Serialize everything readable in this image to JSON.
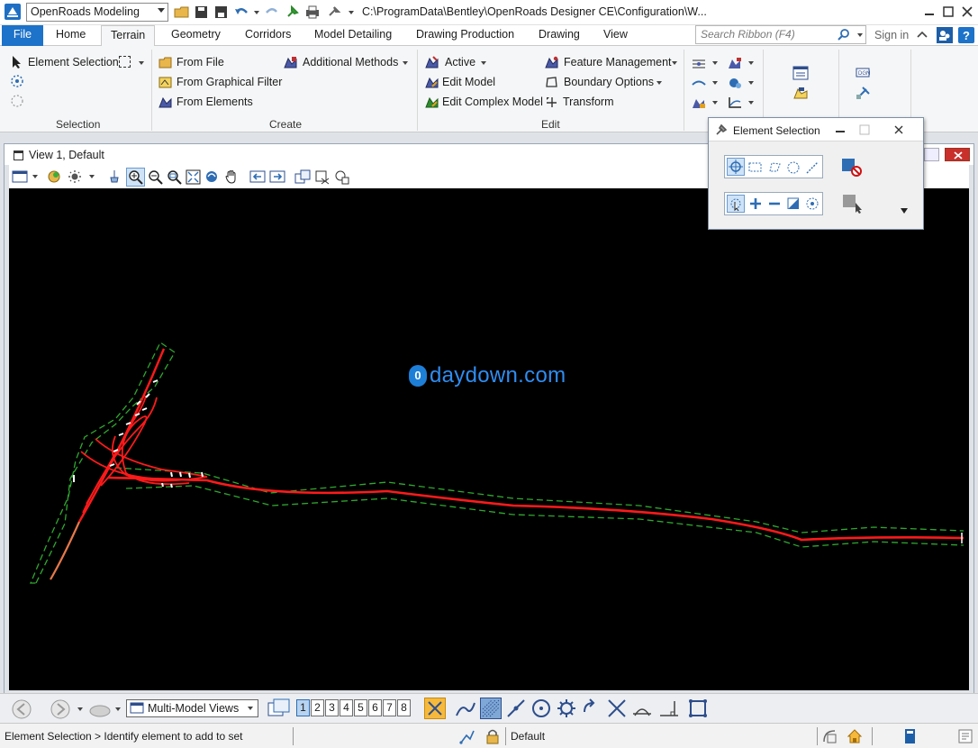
{
  "titlebar": {
    "workflow": "OpenRoads Modeling",
    "path": "C:\\ProgramData\\Bentley\\OpenRoads Designer CE\\Configuration\\W..."
  },
  "tabs": [
    "File",
    "Home",
    "Terrain",
    "Geometry",
    "Corridors",
    "Model Detailing",
    "Drawing Production",
    "Drawing",
    "View"
  ],
  "active_tab": "Terrain",
  "search": {
    "placeholder": "Search Ribbon (F4)"
  },
  "signin": "Sign in",
  "ribbon": {
    "selection": {
      "label": "Selection",
      "element_selection": "Element Selection"
    },
    "create": {
      "label": "Create",
      "from_file": "From File",
      "from_graphical_filter": "From Graphical Filter",
      "from_elements": "From Elements",
      "additional_methods": "Additional Methods"
    },
    "edit": {
      "label": "Edit",
      "active": "Active",
      "edit_model": "Edit Model",
      "edit_complex_model": "Edit Complex Model",
      "feature_management": "Feature Management",
      "boundary_options": "Boundary Options",
      "transform": "Transform"
    }
  },
  "view": {
    "title": "View 1, Default"
  },
  "dialog": {
    "title": "Element Selection"
  },
  "watermark": "daydown.com",
  "watermark_badge": "0",
  "bottom_toolbar": {
    "views_dropdown": "Multi-Model Views",
    "view_numbers": [
      "1",
      "2",
      "3",
      "4",
      "5",
      "6",
      "7",
      "8"
    ],
    "selected_view": "1"
  },
  "statusbar": {
    "prompt": "Element Selection > Identify element to add to set",
    "level": "Default"
  },
  "colors": {
    "accent": "#1d72c9",
    "alignment": "#ff1a1a",
    "boundary": "#2fa82f",
    "viewport_bg": "#000000"
  }
}
